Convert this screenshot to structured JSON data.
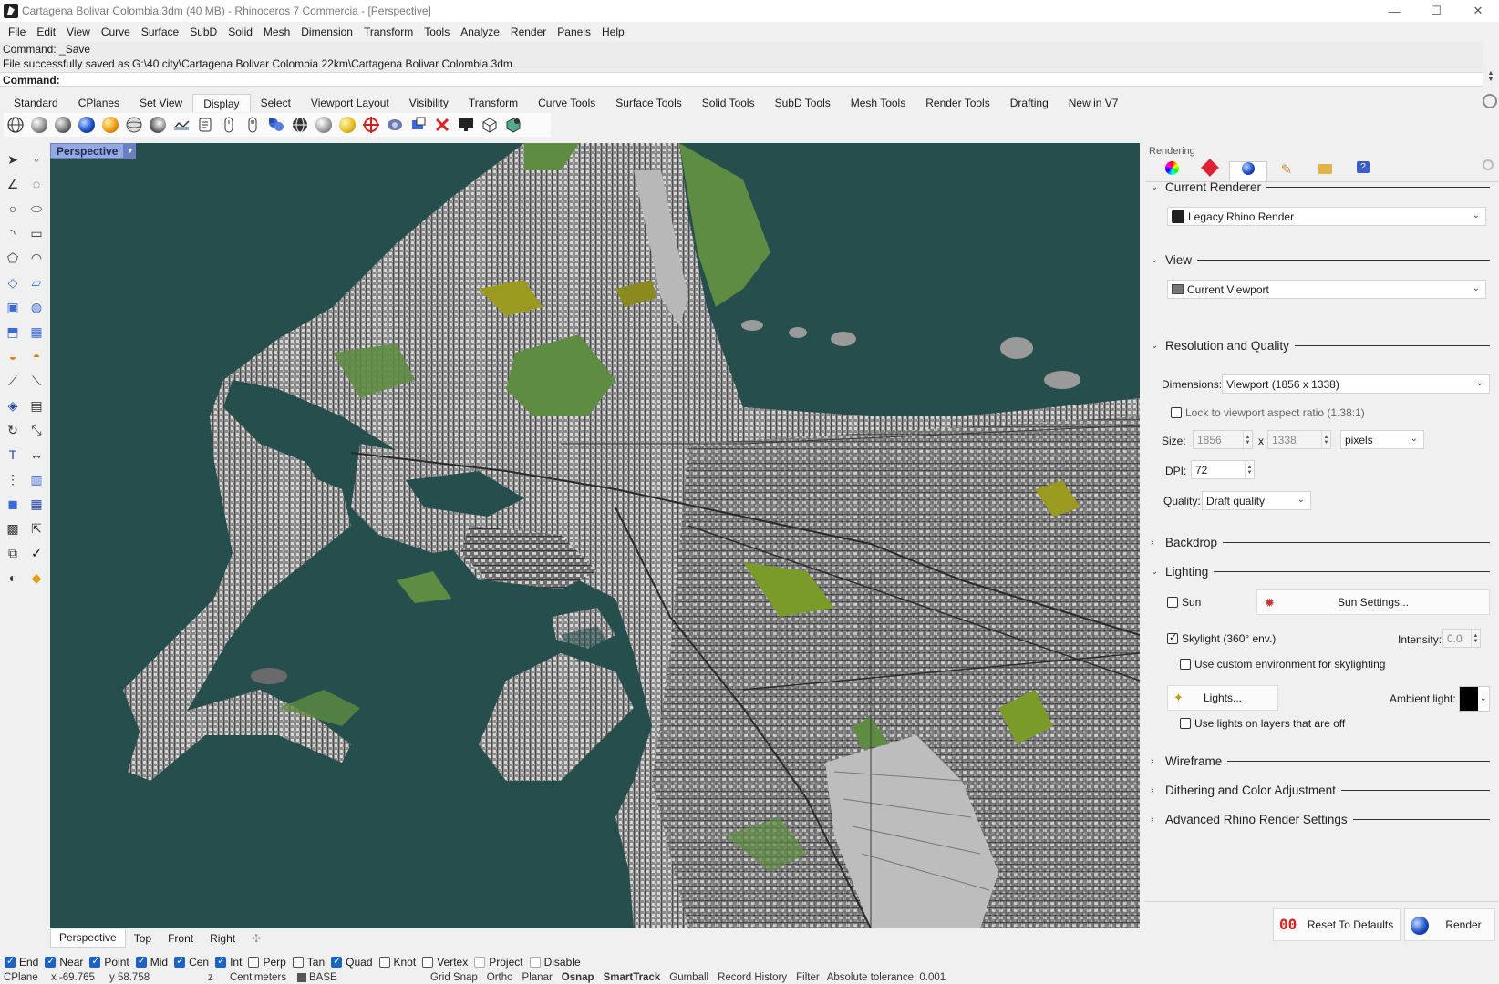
{
  "window": {
    "title": "Cartagena Bolivar Colombia.3dm (40 MB) - Rhinoceros 7 Commercia - [Perspective]",
    "minimize": "—",
    "maximize": "☐",
    "close": "✕"
  },
  "menu": [
    "File",
    "Edit",
    "View",
    "Curve",
    "Surface",
    "SubD",
    "Solid",
    "Mesh",
    "Dimension",
    "Transform",
    "Tools",
    "Analyze",
    "Render",
    "Panels",
    "Help"
  ],
  "command": {
    "history1": "Command: _Save",
    "history2": "File successfully saved as G:\\40 city\\Cartagena Bolivar Colombia 22km\\Cartagena Bolivar Colombia.3dm.",
    "prompt": "Command:"
  },
  "toolbar_tabs": [
    "Standard",
    "CPlanes",
    "Set View",
    "Display",
    "Select",
    "Viewport Layout",
    "Visibility",
    "Transform",
    "Curve Tools",
    "Surface Tools",
    "Solid Tools",
    "SubD Tools",
    "Mesh Tools",
    "Render Tools",
    "Drafting",
    "New in V7"
  ],
  "active_tab": "Display",
  "display_icons": [
    "wireframe-display-icon",
    "shaded-display-icon",
    "rendered-display-icon",
    "blue-sphere-icon",
    "gold-sphere-icon",
    "ghosted-display-icon",
    "xray-display-icon",
    "technical-display-icon",
    "artistic-display-icon",
    "pen-display-icon",
    "arctic-display-icon",
    "monochrome-display-icon",
    "render-preview-icon",
    "ambient-occlusion-icon",
    "raytraced-icon",
    "shaded-sphere-icon",
    "light-bulb-icon",
    "section-icon",
    "environment-icon",
    "disable-icon",
    "monitor-icon",
    "box-icon",
    "box-settings-icon"
  ],
  "viewport": {
    "name": "Perspective",
    "dropdown": "▾",
    "tabs": [
      "Perspective",
      "Top",
      "Front",
      "Right"
    ],
    "add_tab": "✣",
    "colors": {
      "water": "#264e4c",
      "green": "#5e8c42",
      "city": "#9a9a9a"
    }
  },
  "osnap": [
    {
      "label": "End",
      "checked": true
    },
    {
      "label": "Near",
      "checked": true
    },
    {
      "label": "Point",
      "checked": true
    },
    {
      "label": "Mid",
      "checked": true
    },
    {
      "label": "Cen",
      "checked": true
    },
    {
      "label": "Int",
      "checked": true
    },
    {
      "label": "Perp",
      "checked": false
    },
    {
      "label": "Tan",
      "checked": false
    },
    {
      "label": "Quad",
      "checked": true
    },
    {
      "label": "Knot",
      "checked": false
    },
    {
      "label": "Vertex",
      "checked": false
    },
    {
      "label": "Project",
      "checked": false
    },
    {
      "label": "Disable",
      "checked": false
    }
  ],
  "status": {
    "cplane": "CPlane",
    "x": "x -69.765",
    "y": "y 58.758",
    "z": "z",
    "units": "Centimeters",
    "layer": "BASE",
    "grid_snap": "Grid Snap",
    "ortho": "Ortho",
    "planar": "Planar",
    "osnap": "Osnap",
    "smarttrack": "SmartTrack",
    "gumball": "Gumball",
    "record_history": "Record History",
    "filter": "Filter",
    "tolerance": "Absolute tolerance: 0.001"
  },
  "panel": {
    "title": "Rendering",
    "tab_icons": [
      "color-wheel-icon",
      "material-icon",
      "rendering-icon",
      "brush-icon",
      "folder-icon",
      "help-icon"
    ],
    "settings_icon": "gear-icon",
    "current_renderer": {
      "title": "Current Renderer",
      "value": "Legacy Rhino Render"
    },
    "view": {
      "title": "View",
      "value": "Current Viewport"
    },
    "resolution": {
      "title": "Resolution and Quality",
      "dimensions_label": "Dimensions:",
      "dimensions_value": "Viewport (1856 x 1338)",
      "lock_label": "Lock to viewport aspect ratio (1.38:1)",
      "lock_checked": false,
      "size_label": "Size:",
      "width": "1856",
      "x_sep": "x",
      "height": "1338",
      "unit": "pixels",
      "dpi_label": "DPI:",
      "dpi": "72",
      "quality_label": "Quality:",
      "quality": "Draft quality"
    },
    "backdrop": {
      "title": "Backdrop"
    },
    "lighting": {
      "title": "Lighting",
      "sun_label": "Sun",
      "sun_checked": false,
      "sun_settings": "Sun Settings...",
      "skylight_label": "Skylight (360° env.)",
      "skylight_checked": true,
      "intensity_label": "Intensity:",
      "intensity": "0.0",
      "custom_env_label": "Use custom environment for skylighting",
      "custom_env_checked": false,
      "lights_button": "Lights...",
      "ambient_label": "Ambient light:",
      "ambient_color": "#000000",
      "layers_off_label": "Use lights on layers that are off",
      "layers_off_checked": false
    },
    "wireframe": {
      "title": "Wireframe"
    },
    "dithering": {
      "title": "Dithering and Color Adjustment"
    },
    "advanced": {
      "title": "Advanced Rhino Render Settings"
    },
    "reset_button": "Reset To Defaults",
    "render_button": "Render"
  }
}
